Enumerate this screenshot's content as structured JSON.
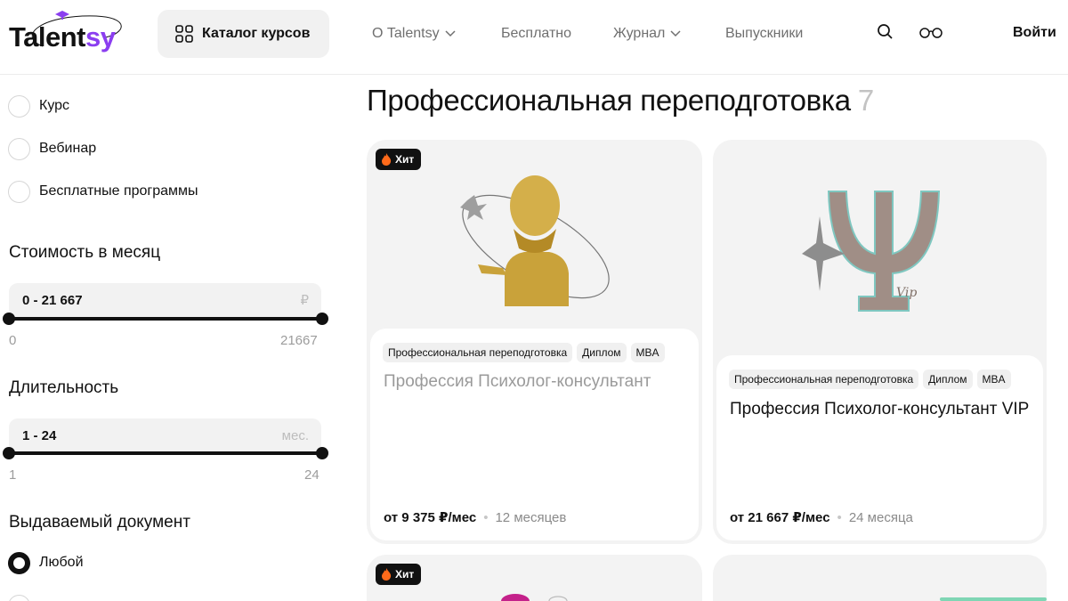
{
  "header": {
    "logo": {
      "text_main": "Talent",
      "text_accent": "sy"
    },
    "catalog_label": "Каталог курсов",
    "nav": [
      {
        "label": "О Talentsy",
        "has_dropdown": true
      },
      {
        "label": "Бесплатно",
        "has_dropdown": false
      },
      {
        "label": "Журнал",
        "has_dropdown": true
      },
      {
        "label": "Выпускники",
        "has_dropdown": false
      }
    ],
    "icons": [
      "search-icon",
      "glasses-icon"
    ],
    "login_label": "Войти"
  },
  "sidebar": {
    "type_options": [
      "Курс",
      "Вебинар",
      "Бесплатные программы"
    ],
    "cost": {
      "title": "Стоимость в месяц",
      "value": "0 - 21 667",
      "unit": "₽",
      "min": "0",
      "max": "21667"
    },
    "duration": {
      "title": "Длительность",
      "value": "1 - 24",
      "unit": "мес.",
      "min": "1",
      "max": "24"
    },
    "document": {
      "title": "Выдаваемый документ",
      "options": [
        {
          "label": "Любой",
          "checked": true
        }
      ]
    }
  },
  "main": {
    "title": "Профессиональная переподготовка",
    "count": "7",
    "cards": [
      {
        "badge": "Хит",
        "image": "freud-bust-illustration",
        "tags": [
          "Профессиональная переподготовка",
          "Диплом",
          "MBA"
        ],
        "title": "Профессия Психолог-консультант",
        "price": "от 9 375 ₽/мес",
        "duration": "12 месяцев"
      },
      {
        "badge": "",
        "image": "psi-vip-illustration",
        "tags": [
          "Профессиональная переподготовка",
          "Диплом",
          "MBA"
        ],
        "title": "Профессия Психолог-консультант VIP",
        "price": "от 21 667 ₽/мес",
        "duration": "24 месяца"
      },
      {
        "badge": "Хит"
      },
      {
        "badge": ""
      }
    ]
  },
  "colors": {
    "accent": "#8b3ef0",
    "card_bg": "#f3f3f3",
    "badge_bg": "#111111",
    "fire": "#ff6a1a",
    "gold": "#c9a23a"
  }
}
